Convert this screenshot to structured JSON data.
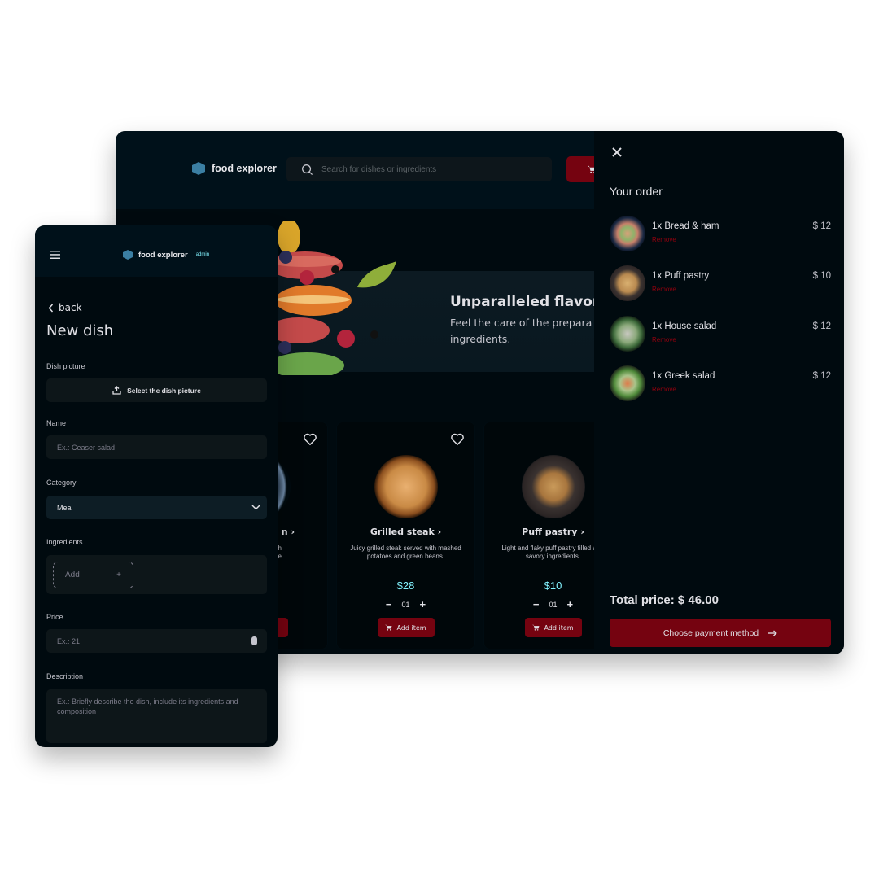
{
  "desktop": {
    "header": {
      "brand": "food explorer",
      "search_placeholder": "Search for dishes or ingredients"
    },
    "banner": {
      "title": "Unparalleled flavors",
      "subtitle_line1": "Feel the care of the prepara",
      "subtitle_line2": "ingredients."
    },
    "cards": [
      {
        "name": "n",
        "description_line1": "d with",
        "description_line2": "d a side"
      },
      {
        "name": "Grilled steak",
        "description": "Juicy grilled steak served with mashed potatoes and green beans.",
        "price": "$28",
        "quantity": "01",
        "add_label": "Add item"
      },
      {
        "name": "Puff pastry",
        "description": "Light and flaky puff pastry filled with savory ingredients.",
        "price": "$10",
        "quantity": "01",
        "add_label": "Add item"
      }
    ]
  },
  "order": {
    "title": "Your order",
    "remove_label": "Remove",
    "items": [
      {
        "name": "1x Bread & ham",
        "price": "$ 12"
      },
      {
        "name": "1x Puff pastry",
        "price": "$ 10"
      },
      {
        "name": "1x House salad",
        "price": "$ 12"
      },
      {
        "name": "1x Greek salad",
        "price": "$ 12"
      }
    ],
    "total": "Total price: $ 46.00",
    "pay_label": "Choose payment method"
  },
  "mobile": {
    "brand": "food explorer",
    "role_tag": "admin",
    "back_label": "back",
    "title": "New dish",
    "fields": {
      "picture_label": "Dish picture",
      "picture_button": "Select the dish picture",
      "name_label": "Name",
      "name_placeholder": "Ex.: Ceaser salad",
      "category_label": "Category",
      "category_value": "Meal",
      "ingredients_label": "Ingredients",
      "ingredients_add": "Add",
      "price_label": "Price",
      "price_placeholder": "Ex.: 21",
      "description_label": "Description",
      "description_placeholder": "Ex.: Briefly describe the dish, include its ingredients and composition"
    }
  },
  "colors": {
    "accent_red": "#750310",
    "price_cyan": "#82f3ff",
    "remove_red": "#92000e",
    "logo_blue": "#3b7fa3"
  }
}
